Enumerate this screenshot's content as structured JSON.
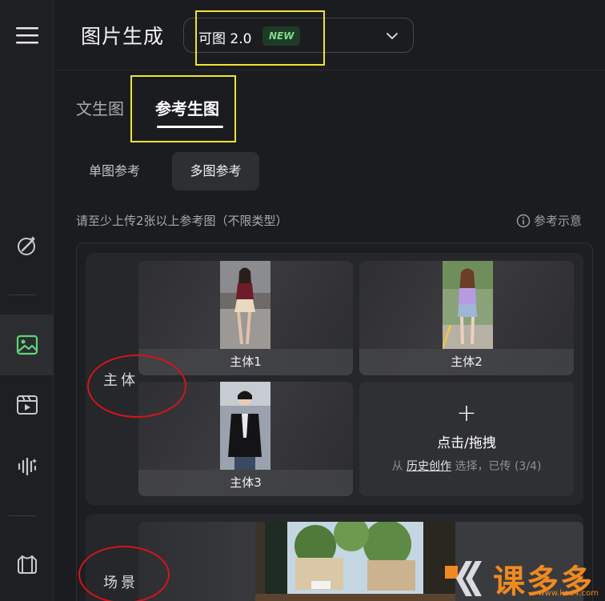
{
  "header": {
    "title": "图片生成",
    "model_name": "可图 2.0",
    "new_badge": "NEW"
  },
  "tabs": [
    {
      "label": "文生图",
      "active": false
    },
    {
      "label": "参考生图",
      "active": true
    }
  ],
  "subtabs": [
    {
      "label": "单图参考",
      "active": false
    },
    {
      "label": "多图参考",
      "active": true
    }
  ],
  "hint": "请至少上传2张以上参考图（不限类型）",
  "example_link": "参考示意",
  "groups": {
    "subject": {
      "label": "主体",
      "cards": [
        {
          "caption": "主体1"
        },
        {
          "caption": "主体2"
        },
        {
          "caption": "主体3"
        }
      ],
      "upload": {
        "plus": "+",
        "title": "点击/拖拽",
        "sub_prefix": "从",
        "sub_link": "历史创作",
        "sub_suffix": "选择，已传 (3/4)"
      }
    },
    "scene": {
      "label": "场景"
    }
  },
  "watermark": {
    "text": "课多多",
    "url": "www.ked4.com"
  },
  "colors": {
    "accent_green": "#5fd37a",
    "highlight_yellow": "#f0e332",
    "annotation_red": "#d4141a",
    "watermark_orange": "#f08a1f"
  }
}
